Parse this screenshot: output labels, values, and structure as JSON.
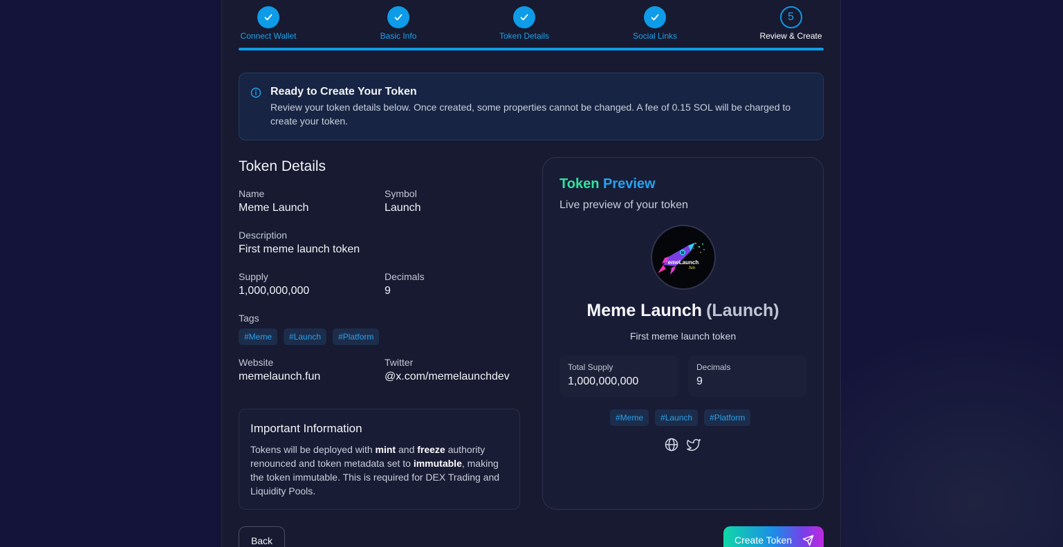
{
  "stepper": {
    "steps": [
      {
        "number": "1",
        "label": "Connect Wallet",
        "status": "complete"
      },
      {
        "number": "2",
        "label": "Basic Info",
        "status": "complete"
      },
      {
        "number": "3",
        "label": "Token Details",
        "status": "complete"
      },
      {
        "number": "4",
        "label": "Social Links",
        "status": "complete"
      },
      {
        "number": "5",
        "label": "Review & Create",
        "status": "current"
      }
    ],
    "progress": 1.0
  },
  "alert": {
    "title": "Ready to Create Your Token",
    "text": "Review your token details below. Once created, some properties cannot be changed. A fee of 0.15 SOL will be charged to create your token.",
    "icon": "info-icon"
  },
  "details": {
    "title": "Token Details",
    "name_label": "Name",
    "name_value": "Meme Launch",
    "symbol_label": "Symbol",
    "symbol_value": "Launch",
    "description_label": "Description",
    "description_value": "First meme launch token",
    "supply_label": "Supply",
    "supply_value": "1,000,000,000",
    "decimals_label": "Decimals",
    "decimals_value": "9",
    "tags_label": "Tags",
    "tags": [
      "#Meme",
      "#Launch",
      "#Platform"
    ],
    "website_label": "Website",
    "website_value": "memelaunch.fun",
    "twitter_label": "Twitter",
    "twitter_value": "@x.com/memelaunchdev"
  },
  "important": {
    "title": "Important Information",
    "text_1": "Tokens will be deployed with ",
    "mint": "mint",
    "text_2": " and ",
    "freeze": "freeze",
    "text_3": " authority renounced and token metadata set to ",
    "immutable": "immutable",
    "text_4": ", making the token immutable. This is required for DEX Trading and Liquidity Pools."
  },
  "preview": {
    "title_part1": "Token",
    "title_part2": "Preview",
    "subtitle": "Live preview of your token",
    "logo_text": "emeLaunch",
    "logo_subtext": ".fun",
    "name": "Meme Launch",
    "symbol": "(Launch)",
    "description": "First meme launch token",
    "supply_label": "Total Supply",
    "supply_value": "1,000,000,000",
    "decimals_label": "Decimals",
    "decimals_value": "9",
    "tags": [
      "#Meme",
      "#Launch",
      "#Platform"
    ]
  },
  "actions": {
    "back_label": "Back",
    "create_label": "Create Token"
  },
  "colors": {
    "accent": "#0e9be8",
    "green": "#2ee3a0",
    "background": "#14143a",
    "panel": "#171a30"
  }
}
